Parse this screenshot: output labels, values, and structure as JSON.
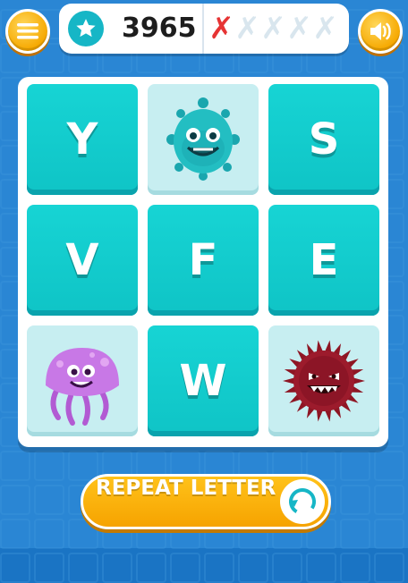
{
  "hud": {
    "score": "3965",
    "mistakes": [
      "✗",
      "✗",
      "✗",
      "✗",
      "✗"
    ],
    "mistakes_used": 1,
    "icons": {
      "menu": "hamburger-icon",
      "star": "star-icon",
      "sound": "speaker-icon"
    }
  },
  "board": {
    "tiles": [
      {
        "type": "letter",
        "value": "Y"
      },
      {
        "type": "monster",
        "monster": "green-virus"
      },
      {
        "type": "letter",
        "value": "S"
      },
      {
        "type": "letter",
        "value": "V"
      },
      {
        "type": "letter",
        "value": "F"
      },
      {
        "type": "letter",
        "value": "E"
      },
      {
        "type": "monster",
        "monster": "purple-jellyfish"
      },
      {
        "type": "letter",
        "value": "W"
      },
      {
        "type": "monster",
        "monster": "red-spiky"
      }
    ]
  },
  "actions": {
    "repeat_label": "REPEAT LETTER"
  },
  "colors": {
    "accent": "#f6a800",
    "tile": "#12cccd",
    "background": "#1a74c4",
    "mistake_active": "#e63434",
    "mistake_empty": "#d9e6ee"
  }
}
